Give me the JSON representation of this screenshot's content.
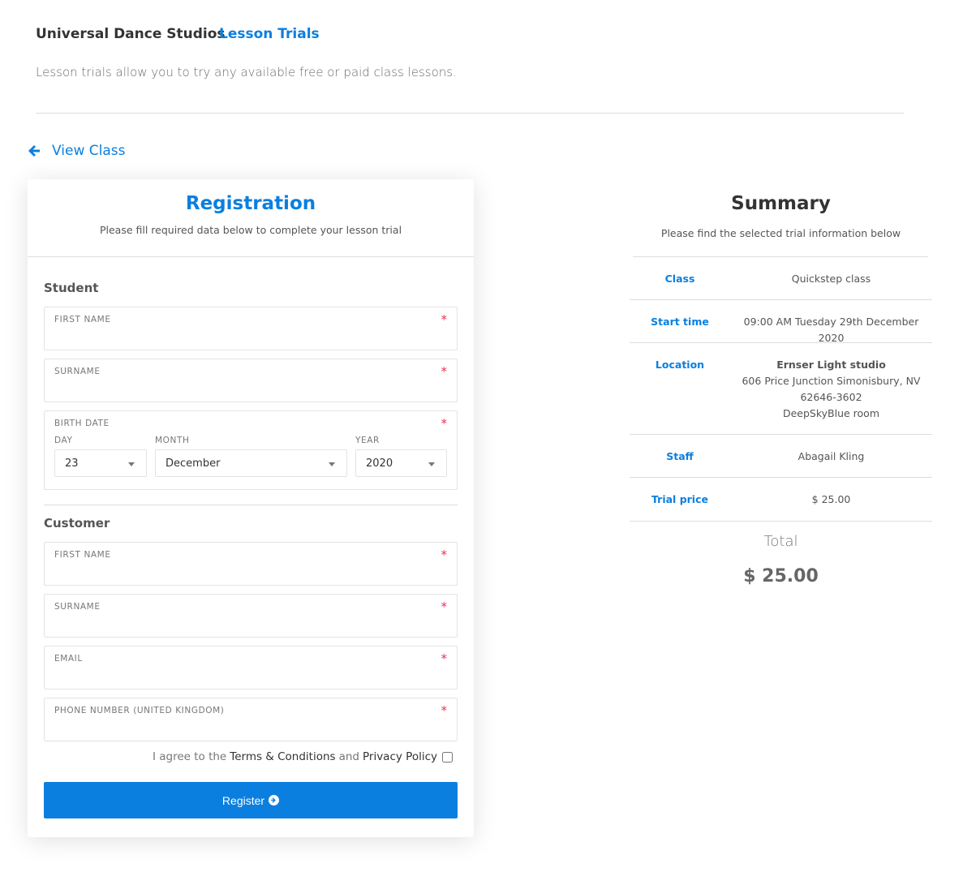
{
  "header": {
    "brand": "Universal Dance Studios",
    "section": "Lesson Trials",
    "intro": "Lesson trials allow you to try any available free or paid class lessons."
  },
  "back_link": {
    "label": "View Class",
    "icon": "arrow-left-icon"
  },
  "registration": {
    "title": "Registration",
    "subtitle": "Please fill required data below to complete your lesson trial",
    "student": {
      "heading": "Student",
      "first_name": "First name",
      "surname": "Surname",
      "birth_date": {
        "label": "Birth date",
        "day_label": "DAY",
        "month_label": "MONTH",
        "year_label": "YEAR",
        "day": "23",
        "month": "December",
        "year": "2020"
      }
    },
    "customer": {
      "heading": "Customer",
      "first_name": "First name",
      "surname": "Surname",
      "email": "Email",
      "phone": "Phone number (United Kingdom)"
    },
    "required_mark": "*",
    "agree": {
      "prefix": "I agree to the",
      "terms": "Terms & Conditions",
      "and": "and",
      "privacy": "Privacy Policy"
    },
    "register_label": "Register"
  },
  "summary": {
    "title": "Summary",
    "subtitle": "Please find the selected trial information below",
    "rows": [
      {
        "label": "Class",
        "value": "Quickstep class"
      },
      {
        "label": "Start time",
        "value": "09:00 AM Tuesday 29th December 2020"
      },
      {
        "label": "Location",
        "name": "Ernser Light studio",
        "address1": "606 Price Junction Simonisbury, NV",
        "address2": "62646-3602",
        "room": "DeepSkyBlue room"
      },
      {
        "label": "Staff",
        "value": "Abagail Kling"
      },
      {
        "label": "Trial price",
        "value": "$ 25.00"
      }
    ],
    "total_label": "Total",
    "total_value": "$ 25.00"
  },
  "colors": {
    "accent": "#0a7fe0",
    "required": "#e8335a"
  }
}
